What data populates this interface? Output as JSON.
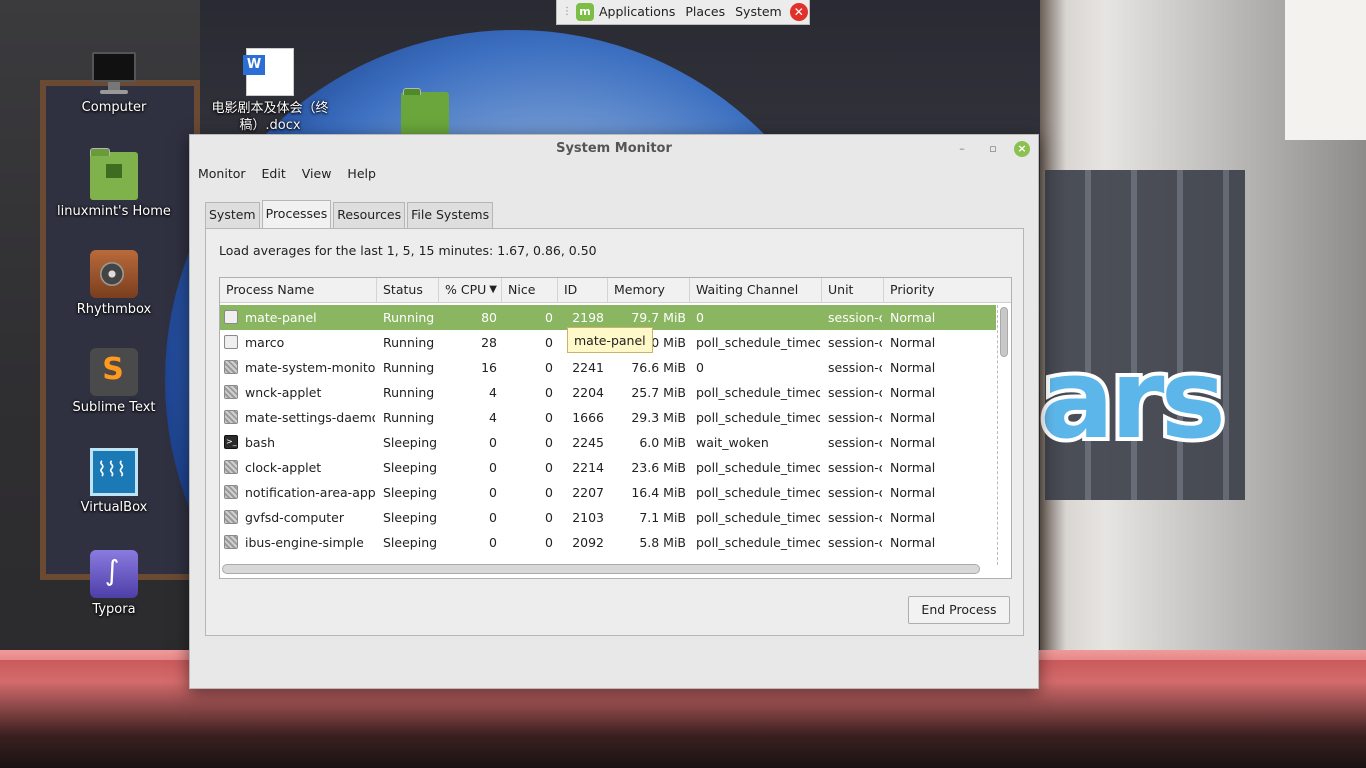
{
  "top_panel": {
    "menus": [
      "Applications",
      "Places",
      "System"
    ]
  },
  "desktop_icons": [
    {
      "label": "Computer",
      "icon": "computer-icon"
    },
    {
      "label": "电影剧本及体会（终稿）.docx",
      "icon": "word-document-icon"
    },
    {
      "label": "linuxmint's Home",
      "icon": "home-folder-icon"
    },
    {
      "label": "Rhythmbox",
      "icon": "rhythmbox-icon"
    },
    {
      "label": "Sublime Text",
      "icon": "sublime-text-icon"
    },
    {
      "label": "VirtualBox",
      "icon": "virtualbox-icon"
    },
    {
      "label": "Typora",
      "icon": "typora-icon"
    }
  ],
  "window": {
    "title": "System Monitor",
    "menu": [
      "Monitor",
      "Edit",
      "View",
      "Help"
    ],
    "tabs": [
      "System",
      "Processes",
      "Resources",
      "File Systems"
    ],
    "active_tab": "Processes",
    "load_averages": "Load averages for the last 1, 5, 15 minutes: 1.67, 0.86, 0.50",
    "columns": [
      "Process Name",
      "Status",
      "% CPU",
      "Nice",
      "ID",
      "Memory",
      "Waiting Channel",
      "Unit",
      "Priority"
    ],
    "sort_column": "% CPU",
    "sort_direction": "descending",
    "selected_row": 0,
    "tooltip": "mate-panel",
    "processes": [
      {
        "name": "mate-panel",
        "status": "Running",
        "cpu": "80",
        "nice": "0",
        "id": "2198",
        "memory": "79.7 MiB",
        "wchan": "0",
        "unit": "session-c",
        "priority": "Normal",
        "icon": "window"
      },
      {
        "name": "marco",
        "status": "Running",
        "cpu": "28",
        "nice": "0",
        "id": "",
        "memory": "45.0 MiB",
        "wchan": "poll_schedule_timeout",
        "unit": "session-c",
        "priority": "Normal",
        "icon": "window"
      },
      {
        "name": "mate-system-monitor",
        "status": "Running",
        "cpu": "16",
        "nice": "0",
        "id": "2241",
        "memory": "76.6 MiB",
        "wchan": "0",
        "unit": "session-c",
        "priority": "Normal",
        "icon": "gear"
      },
      {
        "name": "wnck-applet",
        "status": "Running",
        "cpu": "4",
        "nice": "0",
        "id": "2204",
        "memory": "25.7 MiB",
        "wchan": "poll_schedule_timeout",
        "unit": "session-c",
        "priority": "Normal",
        "icon": "gear"
      },
      {
        "name": "mate-settings-daemon",
        "status": "Running",
        "cpu": "4",
        "nice": "0",
        "id": "1666",
        "memory": "29.3 MiB",
        "wchan": "poll_schedule_timeout",
        "unit": "session-c",
        "priority": "Normal",
        "icon": "gear"
      },
      {
        "name": "bash",
        "status": "Sleeping",
        "cpu": "0",
        "nice": "0",
        "id": "2245",
        "memory": "6.0 MiB",
        "wchan": "wait_woken",
        "unit": "session-c",
        "priority": "Normal",
        "icon": "terminal"
      },
      {
        "name": "clock-applet",
        "status": "Sleeping",
        "cpu": "0",
        "nice": "0",
        "id": "2214",
        "memory": "23.6 MiB",
        "wchan": "poll_schedule_timeout",
        "unit": "session-c",
        "priority": "Normal",
        "icon": "gear"
      },
      {
        "name": "notification-area-applet",
        "status": "Sleeping",
        "cpu": "0",
        "nice": "0",
        "id": "2207",
        "memory": "16.4 MiB",
        "wchan": "poll_schedule_timeout",
        "unit": "session-c",
        "priority": "Normal",
        "icon": "gear"
      },
      {
        "name": "gvfsd-computer",
        "status": "Sleeping",
        "cpu": "0",
        "nice": "0",
        "id": "2103",
        "memory": "7.1 MiB",
        "wchan": "poll_schedule_timeout",
        "unit": "session-c",
        "priority": "Normal",
        "icon": "gear"
      },
      {
        "name": "ibus-engine-simple",
        "status": "Sleeping",
        "cpu": "0",
        "nice": "0",
        "id": "2092",
        "memory": "5.8 MiB",
        "wchan": "poll_schedule_timeout",
        "unit": "session-c",
        "priority": "Normal",
        "icon": "gear"
      }
    ],
    "end_process_label": "End Process"
  },
  "colors": {
    "selection": "#8ab561",
    "mint_green": "#7bbd45",
    "close_red": "#e0322a"
  }
}
